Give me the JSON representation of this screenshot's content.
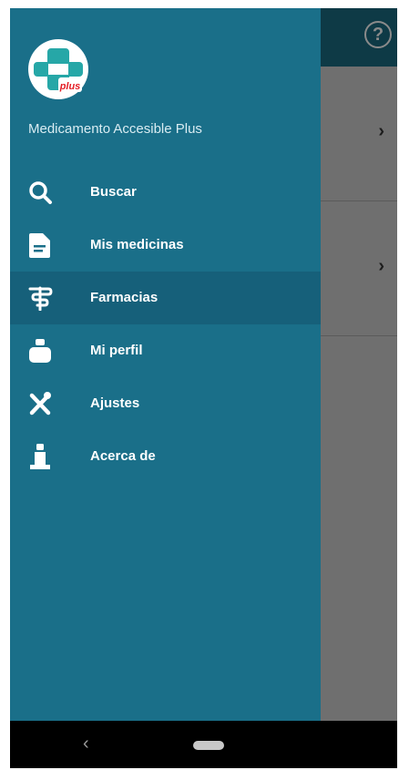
{
  "app": {
    "name": "Medicamento Accesible Plus",
    "logo_text": "plus"
  },
  "colors": {
    "drawer": "#1a6f89",
    "active_item": "#16607a",
    "logo_cross": "#26a7a7",
    "logo_badge": "#e41e26"
  },
  "menu": {
    "items": [
      {
        "label": "Buscar",
        "icon": "search-icon"
      },
      {
        "label": "Mis medicinas",
        "icon": "document-icon"
      },
      {
        "label": "Farmacias",
        "icon": "pharmacy-icon",
        "active": true
      },
      {
        "label": "Mi perfil",
        "icon": "profile-icon"
      },
      {
        "label": "Ajustes",
        "icon": "settings-icon"
      },
      {
        "label": "Acerca de",
        "icon": "info-icon"
      }
    ]
  },
  "background": {
    "help_label": "?",
    "chevron": "›"
  },
  "navbar": {
    "back": "‹"
  }
}
